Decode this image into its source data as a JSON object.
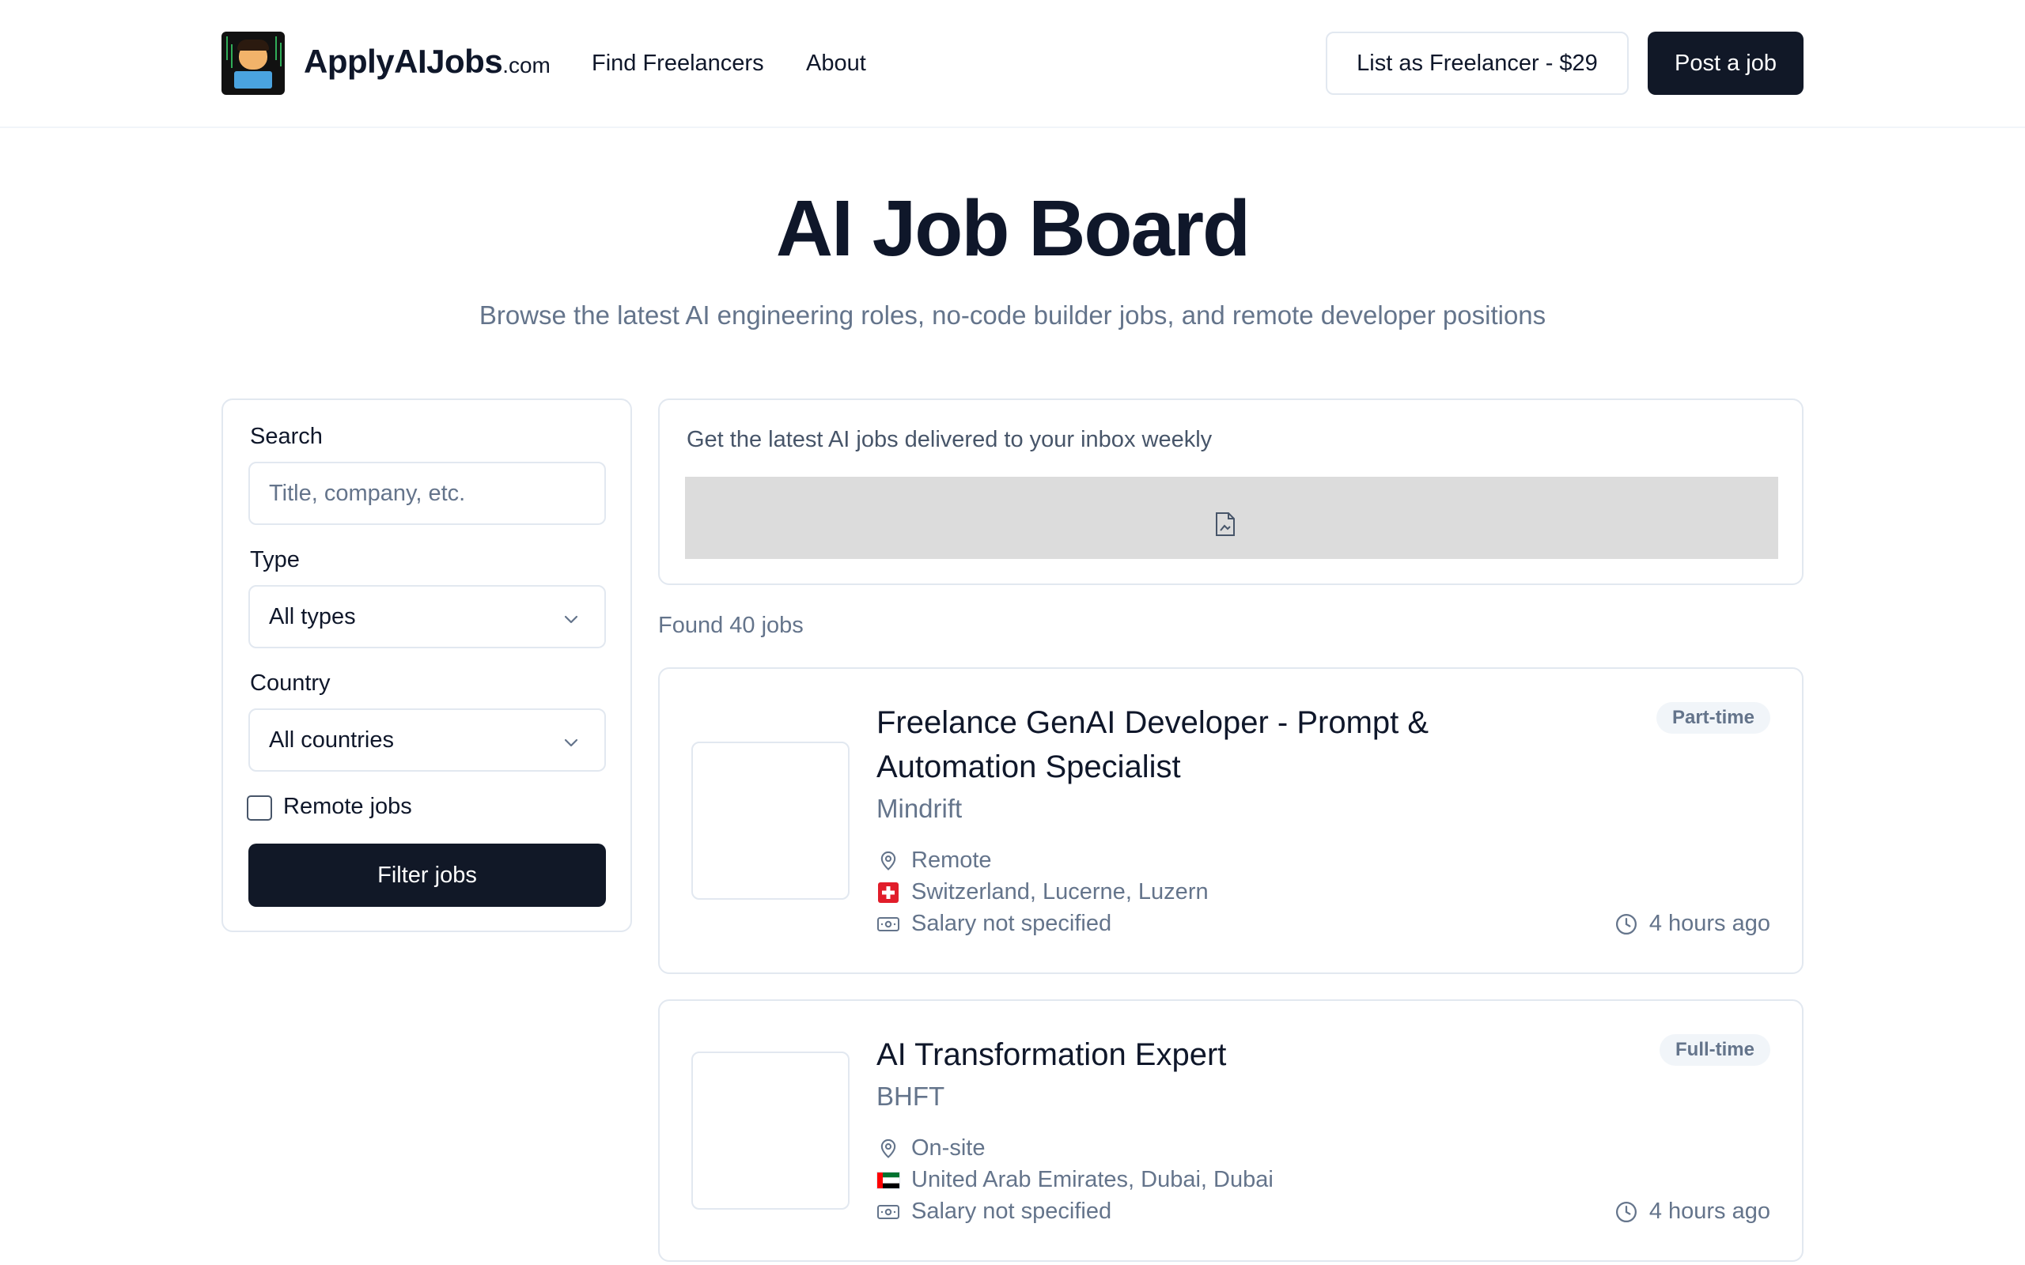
{
  "header": {
    "brand_name": "ApplyAIJobs",
    "brand_tld": ".com",
    "nav": [
      {
        "label": "Find Freelancers"
      },
      {
        "label": "About"
      }
    ],
    "list_freelancer_label": "List as Freelancer - $29",
    "post_job_label": "Post a job"
  },
  "hero": {
    "title": "AI Job Board",
    "subtitle": "Browse the latest AI engineering roles, no-code builder jobs, and remote developer positions"
  },
  "filters": {
    "search_label": "Search",
    "search_placeholder": "Title, company, etc.",
    "search_value": "",
    "type_label": "Type",
    "type_value": "All types",
    "country_label": "Country",
    "country_value": "All countries",
    "remote_label": "Remote jobs",
    "remote_checked": false,
    "filter_button_label": "Filter jobs"
  },
  "newsletter": {
    "text": "Get the latest AI jobs delivered to your inbox weekly",
    "embed_icon": "broken-document-icon"
  },
  "results": {
    "found_text": "Found 40 jobs"
  },
  "jobs": [
    {
      "title": "Freelance GenAI Developer - Prompt & Automation Specialist",
      "company": "Mindrift",
      "work_mode": "Remote",
      "location": "Switzerland, Lucerne, Luzern",
      "flag": "switzerland-flag-icon",
      "salary": "Salary not specified",
      "type": "Part-time",
      "posted": "4 hours ago"
    },
    {
      "title": "AI Transformation Expert",
      "company": "BHFT",
      "work_mode": "On-site",
      "location": "United Arab Emirates, Dubai, Dubai",
      "flag": "uae-flag-icon",
      "salary": "Salary not specified",
      "type": "Full-time",
      "posted": "4 hours ago"
    }
  ],
  "colors": {
    "primary_dark": "#111827",
    "text": "#0f172a",
    "muted": "#64748b",
    "border": "#e2e8f0",
    "badge_bg": "#f1f5f9"
  }
}
